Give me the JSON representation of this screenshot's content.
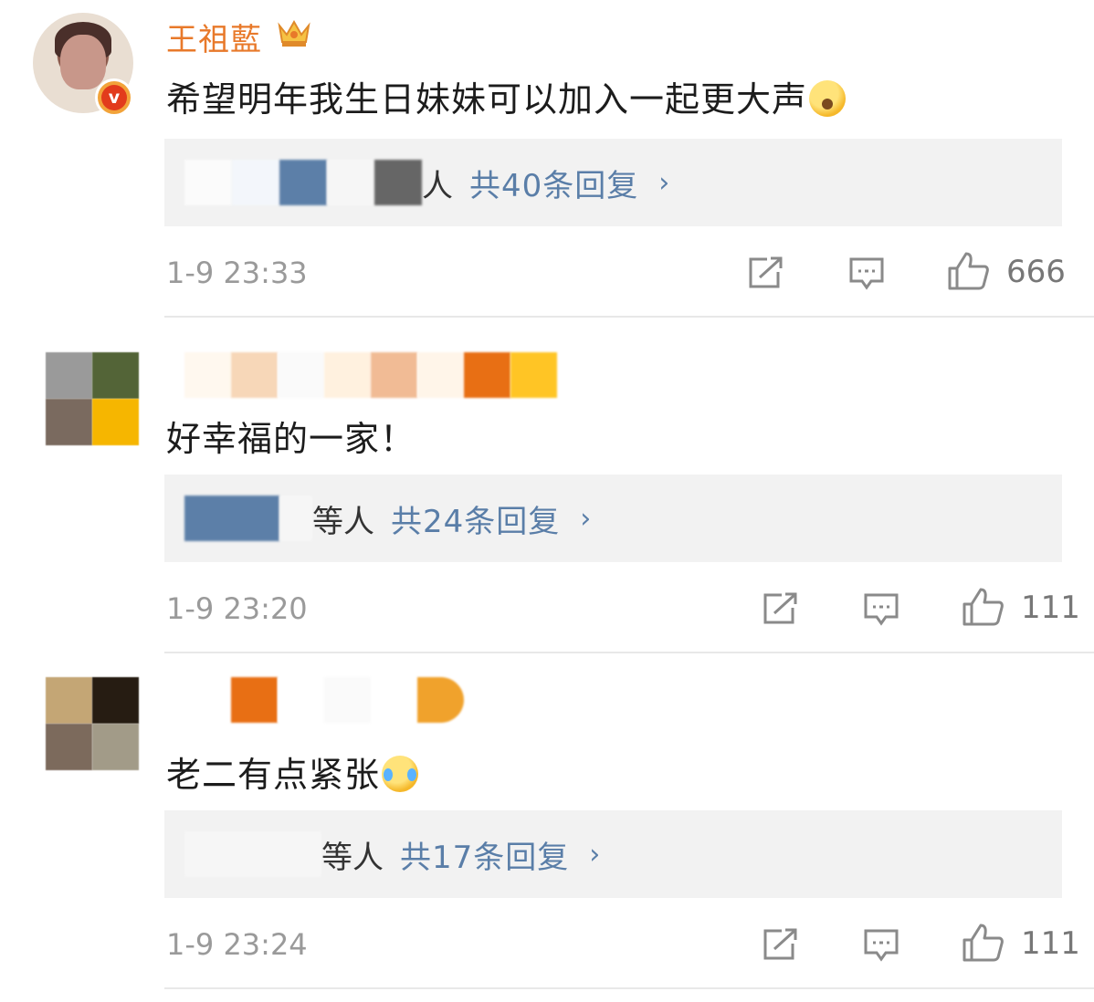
{
  "comments": [
    {
      "username": "王祖藍",
      "text": "希望明年我生日妹妹可以加入一起更大声",
      "reply_suffix": "人",
      "reply_count": "共40条回复",
      "timestamp": "1-9 23:33",
      "likes": "666"
    },
    {
      "text": "好幸福的一家！",
      "reply_suffix": "等人",
      "reply_count": "共24条回复",
      "timestamp": "1-9 23:20",
      "likes": "111"
    },
    {
      "text": "老二有点紧张",
      "reply_suffix": "等人",
      "reply_count": "共17条回复",
      "timestamp": "1-9 23:24",
      "likes": "111"
    }
  ],
  "colors": {
    "username": "#e8792a",
    "link": "#5a7ea8",
    "meta": "#9a9a9a",
    "reply_bg": "#f2f2f2"
  },
  "icons": [
    "crown-icon",
    "verified-badge-icon",
    "yawn-emoji-icon",
    "laugh-cry-emoji-icon",
    "repost-icon",
    "comment-icon",
    "like-icon",
    "chevron-right-icon"
  ]
}
